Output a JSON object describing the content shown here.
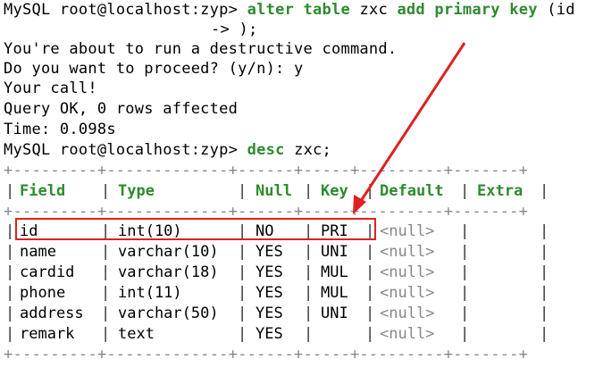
{
  "terminal": {
    "prompt1": "MySQL root@localhost:zyp>",
    "cmd1_kw1": "alter table",
    "cmd1_mid": "zxc",
    "cmd1_kw2": "add primary key",
    "cmd1_tail": "(id",
    "cont_prompt": "->",
    "cont_text": ");",
    "warn1": "You're about to run a destructive command.",
    "warn2": "Do you want to proceed? (y/n): y",
    "warn3": "Your call!",
    "result": "Query OK, 0 rows affected",
    "time": "Time: 0.098s",
    "prompt2": "MySQL root@localhost:zyp>",
    "cmd2_kw": "desc",
    "cmd2_arg": "zxc;"
  },
  "table": {
    "border_top": "+---------+-------------+------+-----+---------+-------+",
    "headers": [
      "Field",
      "Type",
      "Null",
      "Key",
      "Default",
      "Extra"
    ],
    "rows": [
      {
        "field": "id",
        "type": "int(10)",
        "null": "NO",
        "key": "PRI",
        "default": "<null>",
        "extra": ""
      },
      {
        "field": "name",
        "type": "varchar(10)",
        "null": "YES",
        "key": "UNI",
        "default": "<null>",
        "extra": ""
      },
      {
        "field": "cardid",
        "type": "varchar(18)",
        "null": "YES",
        "key": "MUL",
        "default": "<null>",
        "extra": ""
      },
      {
        "field": "phone",
        "type": "int(11)",
        "null": "YES",
        "key": "MUL",
        "default": "<null>",
        "extra": ""
      },
      {
        "field": "address",
        "type": "varchar(50)",
        "null": "YES",
        "key": "UNI",
        "default": "<null>",
        "extra": ""
      },
      {
        "field": "remark",
        "type": "text",
        "null": "YES",
        "key": "",
        "default": "<null>",
        "extra": ""
      }
    ]
  },
  "colors": {
    "keyword": "#2e8b2e",
    "annotation": "#e02020",
    "null_value": "#888888"
  }
}
